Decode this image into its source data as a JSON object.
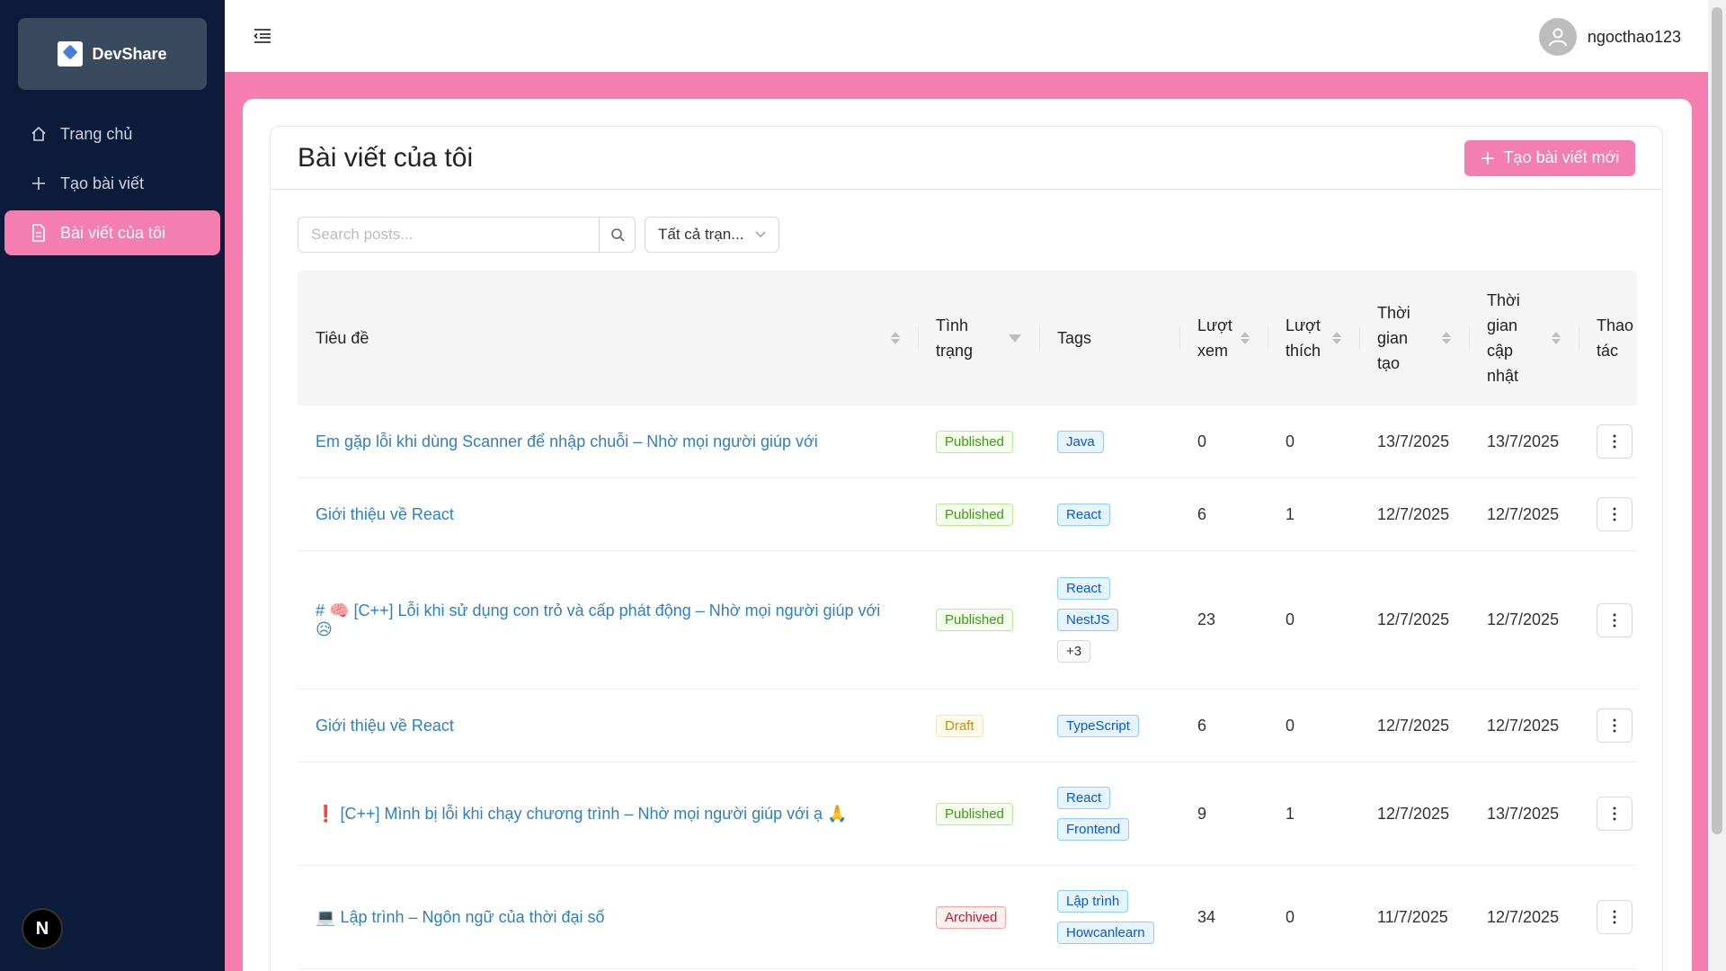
{
  "brand": {
    "name": "DevShare"
  },
  "sidebar": {
    "items": [
      {
        "label": "Trang chủ"
      },
      {
        "label": "Tạo bài viết"
      },
      {
        "label": "Bài viết của tôi"
      }
    ],
    "badge": "N"
  },
  "header": {
    "username": "ngocthao123"
  },
  "page": {
    "title": "Bài viết của tôi",
    "create_label": "Tạo bài viết mới"
  },
  "filters": {
    "search_placeholder": "Search posts...",
    "status_select": "Tất cả trạn..."
  },
  "table": {
    "headers": {
      "title": "Tiêu đề",
      "status": "Tình trạng",
      "tags": "Tags",
      "views": "Lượt xem",
      "likes": "Lượt thích",
      "created": "Thời gian tạo",
      "updated": "Thời gian cập nhật",
      "actions": "Thao tác"
    },
    "rows": [
      {
        "prefix": "",
        "title": "Em gặp lỗi khi dùng Scanner để nhập chuỗi – Nhờ mọi người giúp với",
        "suffix": "",
        "status": "Published",
        "tags": [
          "Java"
        ],
        "views": "0",
        "likes": "0",
        "created": "13/7/2025",
        "updated": "13/7/2025"
      },
      {
        "prefix": "",
        "title": "Giới thiệu về React",
        "suffix": "",
        "status": "Published",
        "tags": [
          "React"
        ],
        "views": "6",
        "likes": "1",
        "created": "12/7/2025",
        "updated": "12/7/2025"
      },
      {
        "prefix": "# 🧠",
        "title": "[C++] Lỗi khi sử dụng con trỏ và cấp phát động – Nhờ mọi người giúp với 😥",
        "suffix": "",
        "status": "Published",
        "tags": [
          "React",
          "NestJS"
        ],
        "more_tags": "+3",
        "views": "23",
        "likes": "0",
        "created": "12/7/2025",
        "updated": "12/7/2025"
      },
      {
        "prefix": "",
        "title": "Giới thiệu về React",
        "suffix": "",
        "status": "Draft",
        "tags": [
          "TypeScript"
        ],
        "views": "6",
        "likes": "0",
        "created": "12/7/2025",
        "updated": "12/7/2025"
      },
      {
        "prefix": "❗",
        "title": "[C++] Mình bị lỗi khi chạy chương trình – Nhờ mọi người giúp với ạ 🙏",
        "suffix": "",
        "status": "Published",
        "tags": [
          "React",
          "Frontend"
        ],
        "views": "9",
        "likes": "1",
        "created": "12/7/2025",
        "updated": "13/7/2025"
      },
      {
        "prefix": "💻",
        "title": "Lập trình – Ngôn ngữ của thời đại số",
        "suffix": "",
        "status": "Archived",
        "tags": [
          "Lập trình",
          "Howcanlearn"
        ],
        "views": "34",
        "likes": "0",
        "created": "11/7/2025",
        "updated": "12/7/2025"
      }
    ]
  },
  "colors": {
    "sidebar": "#0d1b3a",
    "accent": "#f47eb0",
    "link": "#2f7fc1"
  }
}
